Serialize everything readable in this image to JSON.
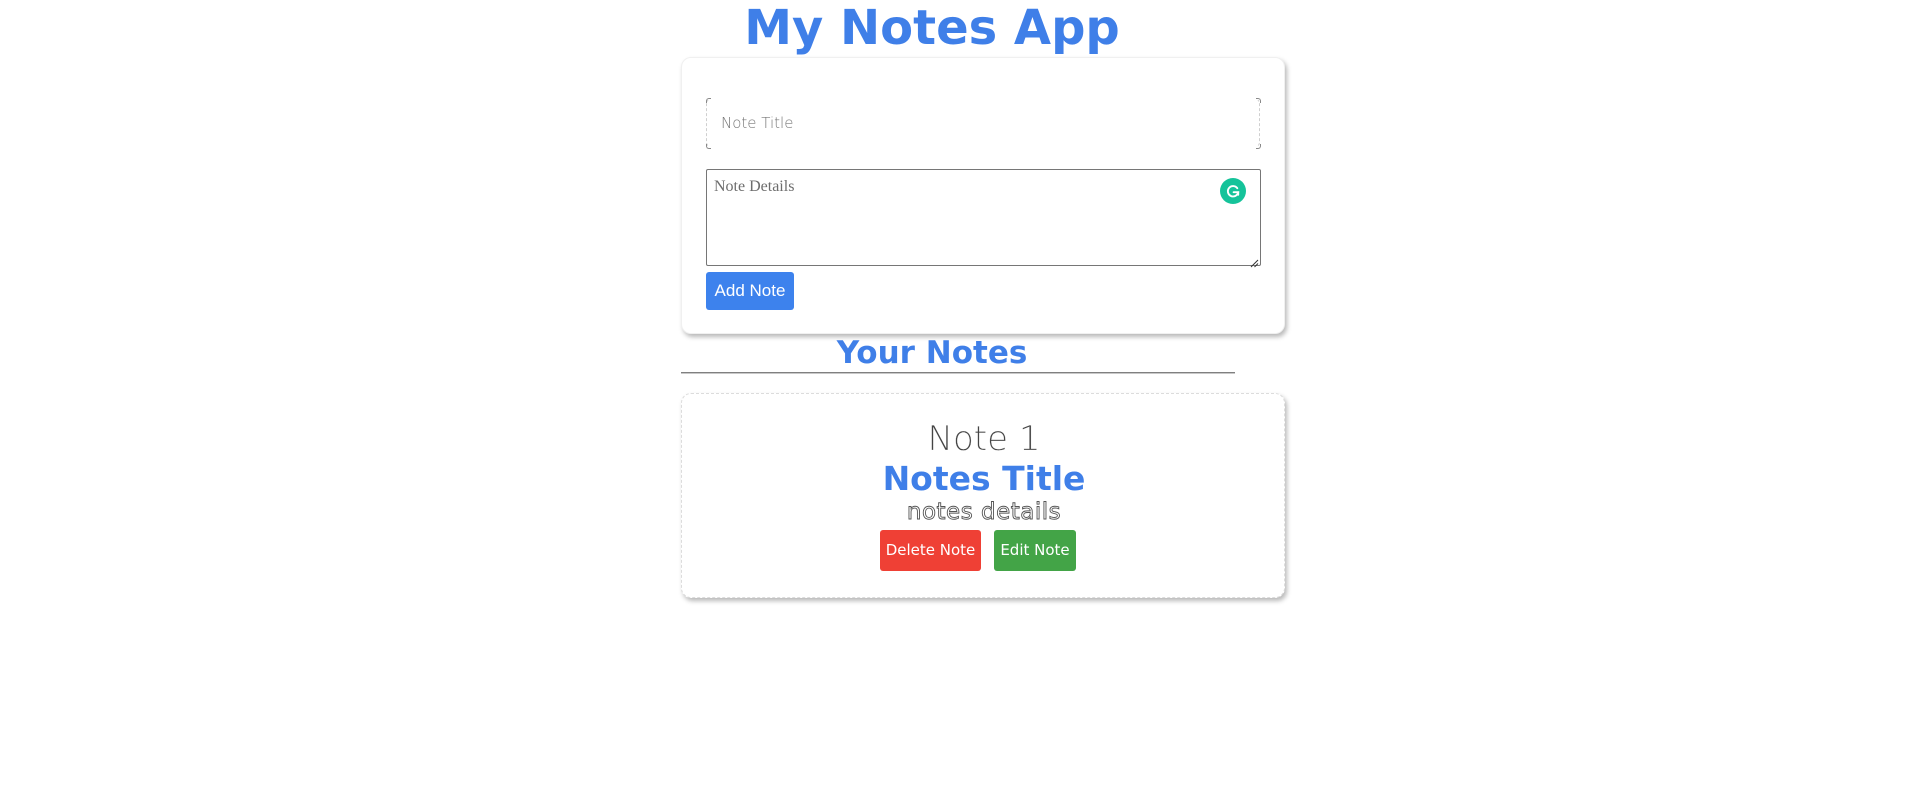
{
  "app": {
    "title": "My Notes App"
  },
  "form": {
    "title_placeholder": "Note Title",
    "title_value": "",
    "details_placeholder": "Note Details",
    "details_value": "",
    "add_button_label": "Add Note"
  },
  "notes_section": {
    "heading": "Your Notes"
  },
  "notes": [
    {
      "number_label": "Note 1",
      "title": "Notes Title",
      "details": "notes details",
      "delete_label": "Delete Note",
      "edit_label": "Edit Note"
    }
  ],
  "colors": {
    "accent": "#3f7fe8",
    "add_button": "#3d82ed",
    "delete_button": "#ef4035",
    "edit_button": "#43a447",
    "grammarly": "#15c39a"
  },
  "icons": {
    "grammarly": "grammarly-icon",
    "resize": "resize-grip-icon"
  }
}
